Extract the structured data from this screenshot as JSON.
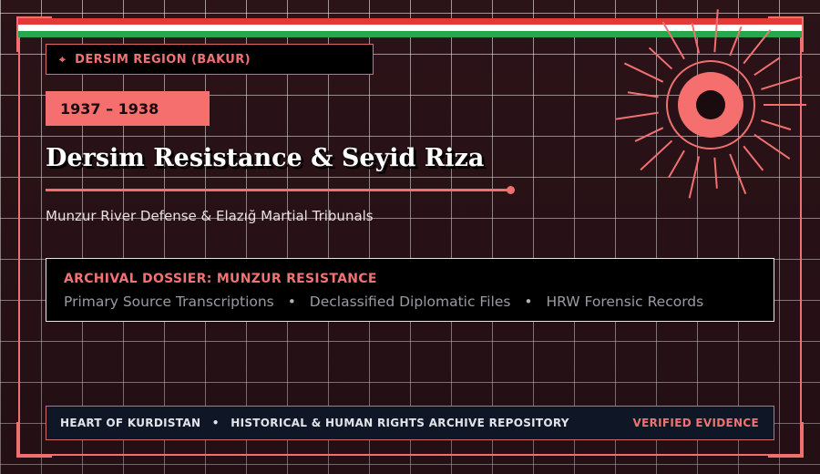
{
  "colors": {
    "accent": "#f07070",
    "background": "#2b1318",
    "flag_red": "#e23a3a",
    "flag_white": "#ffffff",
    "flag_green": "#24a84a",
    "footer_bg": "#0f1726"
  },
  "region_badge": {
    "icon": "map-pin-icon",
    "label": "DERSIM REGION (BAKUR)"
  },
  "years_label": "1937 – 1938",
  "title": "Dersim Resistance & Seyid Riza",
  "subtitle": "Munzur River Defense & Elazığ Martial Tribunals",
  "dossier": {
    "title": "ARCHIVAL DOSSIER: MUNZUR RESISTANCE",
    "items": [
      "Primary Source Transcriptions",
      "Declassified Diplomatic Files",
      "HRW Forensic Records"
    ],
    "separator": "•"
  },
  "footer": {
    "left_part1": "HEART OF KURDISTAN",
    "separator": "•",
    "left_part2": "HISTORICAL & HUMAN RIGHTS ARCHIVE REPOSITORY",
    "right": "VERIFIED EVIDENCE"
  },
  "sun_icon": "sun-emblem-icon"
}
